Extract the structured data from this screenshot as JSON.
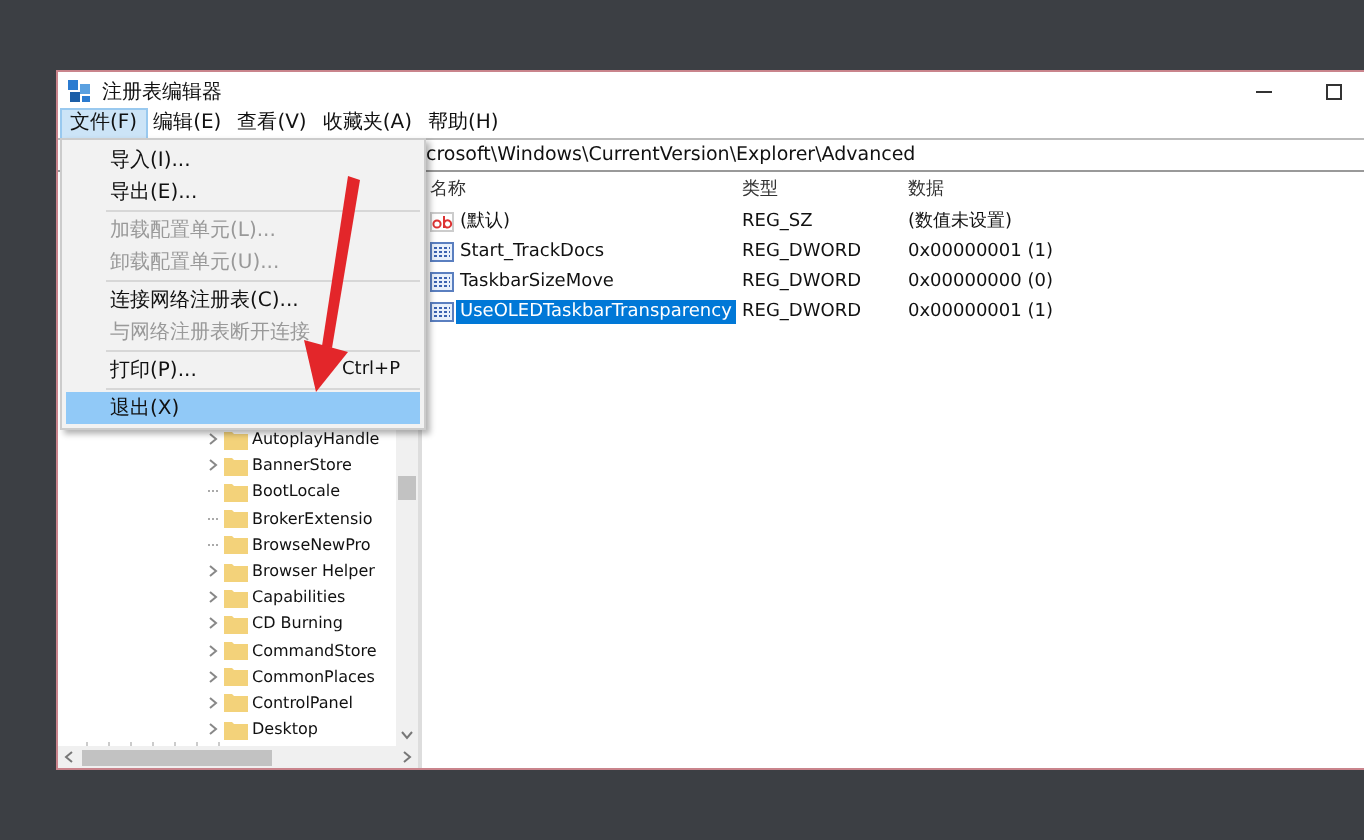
{
  "window": {
    "title": "注册表编辑器"
  },
  "menu_bar": [
    {
      "label": "文件(F)",
      "selected": true
    },
    {
      "label": "编辑(E)",
      "selected": false
    },
    {
      "label": "查看(V)",
      "selected": false
    },
    {
      "label": "收藏夹(A)",
      "selected": false
    },
    {
      "label": "帮助(H)",
      "selected": false
    }
  ],
  "file_menu": [
    {
      "kind": "item",
      "label": "导入(I)...",
      "disabled": false,
      "selected": false
    },
    {
      "kind": "item",
      "label": "导出(E)...",
      "disabled": false,
      "selected": false
    },
    {
      "kind": "separator"
    },
    {
      "kind": "item",
      "label": "加载配置单元(L)...",
      "disabled": true,
      "selected": false
    },
    {
      "kind": "item",
      "label": "卸载配置单元(U)...",
      "disabled": true,
      "selected": false
    },
    {
      "kind": "separator"
    },
    {
      "kind": "item",
      "label": "连接网络注册表(C)...",
      "disabled": false,
      "selected": false
    },
    {
      "kind": "item",
      "label": "与网络注册表断开连接",
      "disabled": true,
      "selected": false
    },
    {
      "kind": "separator"
    },
    {
      "kind": "item",
      "label": "打印(P)...",
      "shortcut": "Ctrl+P",
      "disabled": false,
      "selected": false
    },
    {
      "kind": "separator"
    },
    {
      "kind": "item",
      "label": "退出(X)",
      "disabled": false,
      "selected": true
    }
  ],
  "address": "crosoft\\Windows\\CurrentVersion\\Explorer\\Advanced",
  "tree": [
    {
      "label": "AutoplayHandle",
      "expandable": true
    },
    {
      "label": "BannerStore",
      "expandable": true
    },
    {
      "label": "BootLocale",
      "expandable": false
    },
    {
      "label": "BrokerExtensio",
      "expandable": false
    },
    {
      "label": "BrowseNewPro",
      "expandable": false
    },
    {
      "label": "Browser Helper",
      "expandable": true
    },
    {
      "label": "Capabilities",
      "expandable": true
    },
    {
      "label": "CD Burning",
      "expandable": true
    },
    {
      "label": "CommandStore",
      "expandable": true
    },
    {
      "label": "CommonPlaces",
      "expandable": true
    },
    {
      "label": "ControlPanel",
      "expandable": true
    },
    {
      "label": "Desktop",
      "expandable": true
    }
  ],
  "table": {
    "columns": [
      "名称",
      "类型",
      "数据"
    ],
    "rows": [
      {
        "kind": "string",
        "name": "(默认)",
        "type": "REG_SZ",
        "data": "(数值未设置)",
        "selected": false
      },
      {
        "kind": "binary",
        "name": "Start_TrackDocs",
        "type": "REG_DWORD",
        "data": "0x00000001 (1)",
        "selected": false
      },
      {
        "kind": "binary",
        "name": "TaskbarSizeMove",
        "type": "REG_DWORD",
        "data": "0x00000000 (0)",
        "selected": false
      },
      {
        "kind": "binary",
        "name": "UseOLEDTaskbarTransparency",
        "type": "REG_DWORD",
        "data": "0x00000001 (1)",
        "selected": true
      }
    ]
  }
}
